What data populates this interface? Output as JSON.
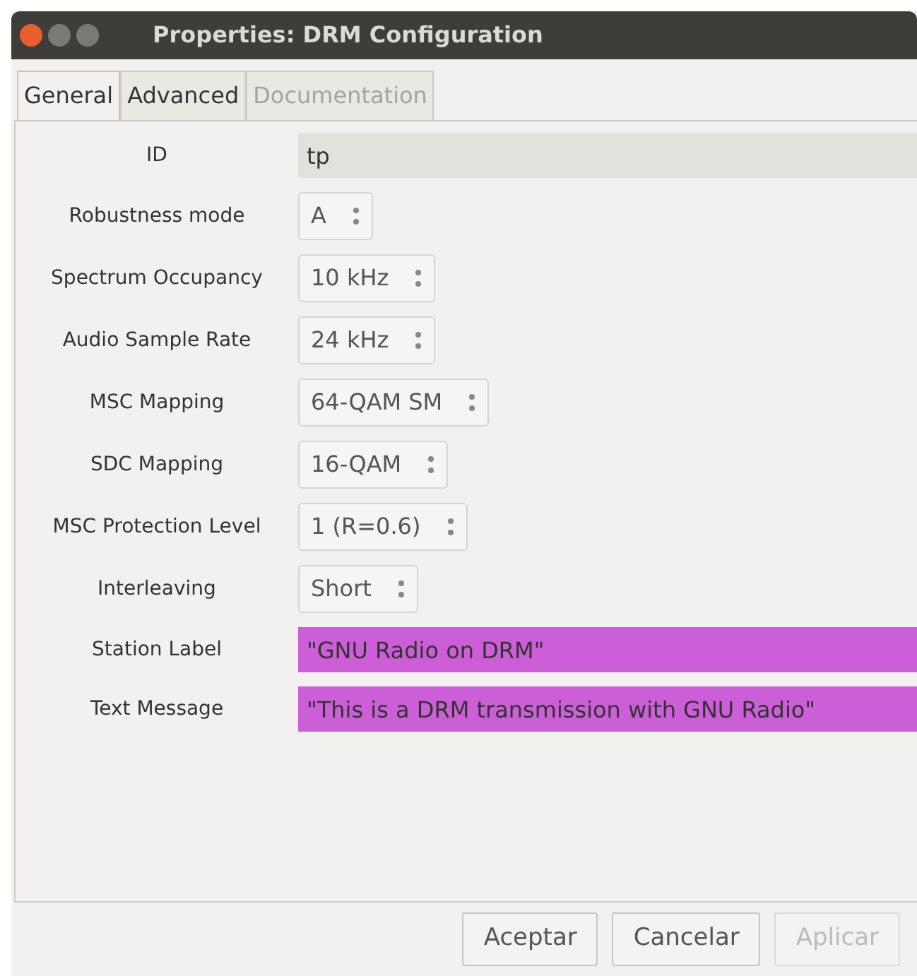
{
  "window": {
    "title": "Properties: DRM Configuration"
  },
  "tabs": [
    {
      "label": "General",
      "selected": true,
      "disabled": false
    },
    {
      "label": "Advanced",
      "selected": false,
      "disabled": false
    },
    {
      "label": "Documentation",
      "selected": false,
      "disabled": true
    }
  ],
  "fields": [
    {
      "label": "ID",
      "kind": "entry",
      "value": "tp",
      "color": "#e2e1de"
    },
    {
      "label": "Robustness mode",
      "kind": "combo",
      "value": "A"
    },
    {
      "label": "Spectrum Occupancy",
      "kind": "combo",
      "value": "10 kHz"
    },
    {
      "label": "Audio Sample Rate",
      "kind": "combo",
      "value": "24 kHz"
    },
    {
      "label": "MSC Mapping",
      "kind": "combo",
      "value": "64-QAM SM"
    },
    {
      "label": "SDC Mapping",
      "kind": "combo",
      "value": "16-QAM"
    },
    {
      "label": "MSC Protection Level",
      "kind": "combo",
      "value": "1 (R=0.6)"
    },
    {
      "label": "Interleaving",
      "kind": "combo",
      "value": "Short"
    },
    {
      "label": "Station Label",
      "kind": "entry",
      "value": "\"GNU Radio on DRM\"",
      "color": "#cc5fd8"
    },
    {
      "label": "Text Message",
      "kind": "entry",
      "value": "\"This is a DRM transmission with GNU Radio\"",
      "color": "#cc5fd8"
    }
  ],
  "buttons": [
    {
      "label": "Aceptar",
      "disabled": false
    },
    {
      "label": "Cancelar",
      "disabled": false
    },
    {
      "label": "Aplicar",
      "disabled": true
    }
  ]
}
